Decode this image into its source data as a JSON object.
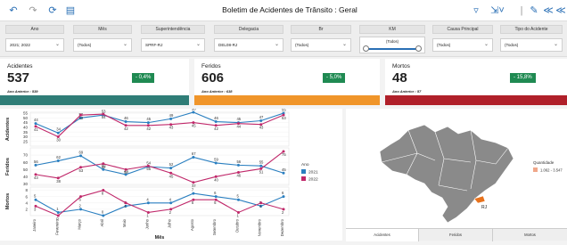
{
  "app": {
    "title": "Boletim de Acidentes de Trânsito : Geral"
  },
  "toolbar": {
    "icons": [
      "undo-icon",
      "redo-icon",
      "refresh-icon",
      "report-icon",
      "filter-icon",
      "export-icon",
      "edit-icon",
      "collapse-icon",
      "more-icon"
    ]
  },
  "filters": [
    {
      "label": "Ano",
      "value": "2021; 2022"
    },
    {
      "label": "Mês",
      "value": "(Todos)"
    },
    {
      "label": "Superintendência",
      "value": "SPRF-RJ"
    },
    {
      "label": "Delegacia",
      "value": "DEL08-RJ"
    },
    {
      "label": "Br",
      "value": "(Todos)"
    },
    {
      "label": "KM",
      "value": "(Todos)"
    },
    {
      "label": "Causa Principal",
      "value": "(Todos)"
    },
    {
      "label": "Tipo do Acidente",
      "value": "(Todos)"
    }
  ],
  "kpis": [
    {
      "label": "Acidentes",
      "value": "537",
      "change": "- 0,4%",
      "previous": "Ano Anterior : 539",
      "bar_color": "#2f7d77"
    },
    {
      "label": "Feridos",
      "value": "606",
      "change": "- 5,0%",
      "previous": "Ano Anterior : 638",
      "bar_color": "#f0952a"
    },
    {
      "label": "Mortos",
      "value": "48",
      "change": "- 15,8%",
      "previous": "Ano Anterior : 57",
      "bar_color": "#b0202a"
    }
  ],
  "chart_data": {
    "type": "line",
    "categories": [
      "Janeiro",
      "Fevereiro",
      "Março",
      "Abril",
      "Maio",
      "Junho",
      "Julho",
      "Agosto",
      "Setembro",
      "Outubro",
      "Novembro",
      "Dezembro"
    ],
    "xlabel": "Mês",
    "legend_title": "Ano",
    "legend": [
      {
        "name": "2021",
        "color": "#2a7fc0"
      },
      {
        "name": "2022",
        "color": "#c0286a"
      }
    ],
    "panels": [
      {
        "ylabel": "Acidentes",
        "ylim": [
          20,
          56
        ],
        "ticks": [
          25,
          30,
          35,
          40,
          45,
          50,
          55
        ],
        "series": [
          {
            "name": "2021",
            "values": [
              44,
              34,
              50,
              53,
              46,
              45,
              49,
              56,
              46,
              45,
              47,
              55
            ]
          },
          {
            "name": "2022",
            "values": [
              41,
              30,
              53,
              54,
              42,
              42,
              43,
              45,
              42,
              44,
              43,
              53
            ]
          }
        ]
      },
      {
        "ylabel": "Feridos",
        "ylim": [
          28,
          80
        ],
        "ticks": [
          30,
          40,
          50,
          60,
          70
        ],
        "series": [
          {
            "name": "2021",
            "values": [
              56,
              62,
              69,
              50,
              43,
              54,
              52,
              67,
              59,
              56,
              55,
              45
            ]
          },
          {
            "name": "2022",
            "values": [
              43,
              38,
              53,
              58,
              50,
              55,
              45,
              32,
              40,
              46,
              51,
              75
            ]
          }
        ]
      },
      {
        "ylabel": "Mortos",
        "ylim": [
          0,
          9
        ],
        "ticks": [
          2,
          4,
          6,
          8
        ],
        "series": [
          {
            "name": "2021",
            "values": [
              5,
              1,
              2,
              0,
              3,
              4,
              4,
              7,
              6,
              5,
              3,
              6
            ]
          },
          {
            "name": "2022",
            "values": [
              3,
              0,
              6,
              8,
              4,
              1,
              2,
              5,
              5,
              1,
              4,
              2
            ]
          }
        ]
      }
    ]
  },
  "map": {
    "legend_title": "Quantidade",
    "legend_range": "1.062 - 3.547",
    "state_label": "RJ"
  },
  "tabs": [
    "Acidentes",
    "Feridos",
    "Mortos"
  ]
}
